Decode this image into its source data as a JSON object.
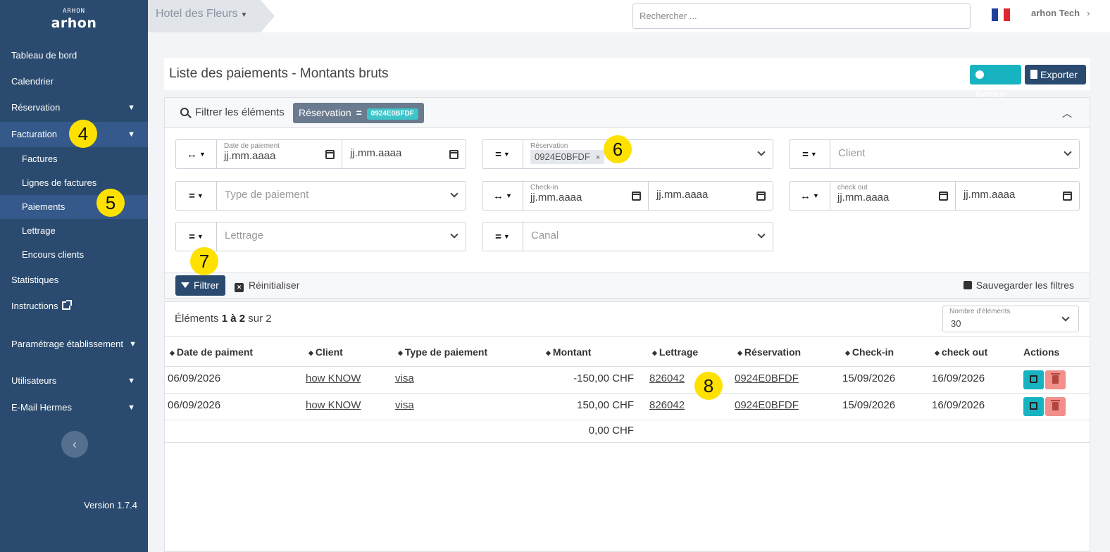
{
  "sidebar": {
    "logo_mark": "ARHON",
    "logo_text": "arhon",
    "items": [
      {
        "label": "Tableau de bord"
      },
      {
        "label": "Calendrier"
      },
      {
        "label": "Réservation"
      },
      {
        "label": "Facturation"
      },
      {
        "label": "Statistiques"
      },
      {
        "label": "Instructions"
      },
      {
        "label": "Paramétrage établissement"
      },
      {
        "label": "Utilisateurs"
      },
      {
        "label": "E-Mail Hermes"
      }
    ],
    "sub_items": [
      {
        "label": "Factures"
      },
      {
        "label": "Lignes de factures"
      },
      {
        "label": "Paiements"
      },
      {
        "label": "Lettrage"
      },
      {
        "label": "Encours clients"
      }
    ],
    "collapse_glyph": "‹",
    "version": "Version 1.7.4"
  },
  "markers": [
    "4",
    "5",
    "6",
    "7",
    "8"
  ],
  "topbar": {
    "breadcrumb": "Hotel des Fleurs",
    "search_placeholder": "Rechercher ...",
    "user": "arhon Tech",
    "flag_colors": [
      "#1f3f9a",
      "#ffffff",
      "#e0262e"
    ]
  },
  "header": {
    "title": "Liste des paiements - Montants bruts",
    "retour_label": "Retour",
    "exporter_label": "Exporter"
  },
  "filters": {
    "title": "Filtrer les éléments",
    "chip_label": "Réservation",
    "chip_value": "0924E0BFDF",
    "date_paiement_label": "Date de paiement",
    "date_placeholder": "jj.mm.aaaa",
    "reservation_label": "Réservation",
    "reservation_tag": "0924E0BFDF",
    "client_placeholder": "Client",
    "type_paiement_placeholder": "Type de paiement",
    "checkin_label": "Check-in",
    "checkout_label": "check out",
    "lettrage_placeholder": "Lettrage",
    "canal_placeholder": "Canal",
    "op_range": "↔",
    "op_equals": "=",
    "filter_btn": "Filtrer",
    "reset_btn": "Réinitialiser",
    "save_btn": "Sauvegarder les filtres"
  },
  "table": {
    "count_prefix": "Éléments",
    "count_range": "1 à 2",
    "count_suffix": "sur 2",
    "page_size_label": "Nombre d'éléments",
    "page_size": "30",
    "columns": [
      "Date de paiment",
      "Client",
      "Type de paiement",
      "Montant",
      "Lettrage",
      "Réservation",
      "Check-in",
      "check out",
      "Actions"
    ],
    "rows": [
      {
        "date": "06/09/2026",
        "client": "how KNOW",
        "type": "visa",
        "montant": "-150,00 CHF",
        "lettrage": "826042",
        "reservation": "0924E0BFDF",
        "checkin": "15/09/2026",
        "checkout": "16/09/2026"
      },
      {
        "date": "06/09/2026",
        "client": "how KNOW",
        "type": "visa",
        "montant": "150,00 CHF",
        "lettrage": "826042",
        "reservation": "0924E0BFDF",
        "checkin": "15/09/2026",
        "checkout": "16/09/2026"
      }
    ],
    "total": "0,00 CHF"
  }
}
